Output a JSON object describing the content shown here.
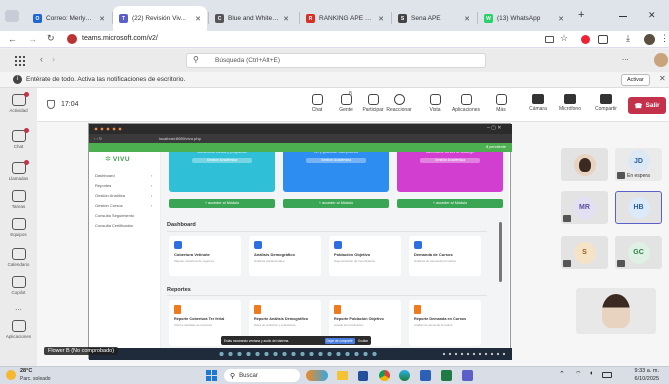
{
  "browser": {
    "tabs": [
      {
        "label": "Correo: Merlyn Elena",
        "fav_color": "#1e66d0",
        "fav": "O"
      },
      {
        "label": "(22) Revisión Viv...",
        "fav_color": "#5b5fc7",
        "fav": "T"
      },
      {
        "label": "Blue and White Mod...",
        "fav_color": "#555555",
        "fav": "C"
      },
      {
        "label": "RANKING APE SEMA...",
        "fav_color": "#d93025",
        "fav": "R"
      },
      {
        "label": "Sena APE",
        "fav_color": "#444444",
        "fav": "S"
      },
      {
        "label": "(13) WhatsApp",
        "fav_color": "#25d366",
        "fav": "W"
      }
    ],
    "new_tab": "+",
    "url": "teams.microsoft.com/v2/"
  },
  "teams": {
    "search_placeholder": "Búsqueda (Ctrl+Alt+E)",
    "more": "...",
    "notice": "Entérate de todo. Activa las notificaciones de escritorio.",
    "notice_button": "Activar",
    "rail": [
      "Actividad",
      "Chat",
      "Llamadas",
      "Tareas",
      "Equipos",
      "Calendario",
      "Copilot",
      "...",
      "Aplicaciones"
    ],
    "meeting": {
      "timer": "17:04",
      "controls": [
        "Chat",
        "Gente",
        "Participar",
        "Reaccionar",
        "Vista",
        "Aplicaciones",
        "Más",
        "Cámara",
        "Micrófono",
        "Compartir"
      ],
      "people_count": "8",
      "leave": "Salir"
    },
    "participants": [
      {
        "initials": "JD",
        "status": "En espera",
        "color": "#dde8f5",
        "text_color": "#2a5fa0"
      },
      {
        "initials": "MR",
        "color": "#e4e0f4",
        "text_color": "#5b4fa0"
      },
      {
        "initials": "HB",
        "color": "#dce9f8",
        "text_color": "#2a5fa0"
      },
      {
        "initials": "S",
        "color": "#f5e3c8",
        "text_color": "#9a5b15"
      },
      {
        "initials": "GC",
        "color": "#dff0e4",
        "text_color": "#2e7d48"
      }
    ],
    "presenter_label": "Flower B (No comprobado)"
  },
  "shared": {
    "url": "localhost:8080/vivu.php",
    "logo": "VIVU",
    "header_right": "8 pendiente",
    "sidebar": [
      "Dashboard",
      "Reportes",
      "Gestión Analítica",
      "Gestión Cursos",
      "Consulta Seguimiento",
      "Consulta Certificados"
    ],
    "cards": [
      {
        "title": "Gestión de Cursos",
        "sub": "Administrar cursos y programas",
        "btn": "Gestión Académica",
        "color": "#2fbfd6"
      },
      {
        "title": "Gestión de Cursos",
        "sub": "Ver y gestionar inscripciones",
        "btn": "Gestión Académica",
        "color": "#2e8df0"
      },
      {
        "title": "Gestión de Cursos",
        "sub": "Administrar cursos de catálogo",
        "btn": "Gestión Académica",
        "color": "#d23fd0"
      }
    ],
    "access_label": "+ acceder al Módulo",
    "dashboard_title": "Dashboard",
    "dashboard_cards": [
      {
        "title": "Cobertura Vetinote",
        "sub": "Mapear cobertura de regiones",
        "color": "#2e6fe0"
      },
      {
        "title": "Análisis Demográfico",
        "sub": "Gráficas poblacionales",
        "color": "#2e6fe0"
      },
      {
        "title": "Población Objetivo",
        "sub": "Segmentación de beneficiarios",
        "color": "#2e6fe0"
      },
      {
        "title": "Demanda de Cursos",
        "sub": "Gráficas de demanda formativa",
        "color": "#2e6fe0"
      }
    ],
    "reports_title": "Reportes",
    "report_cards": [
      {
        "title": "Reporte Cobertura Ter ferial",
        "sub": "Informe detallado de cobertura"
      },
      {
        "title": "Reporte Análisis Demográfico",
        "sub": "Datos de población y estadísticas"
      },
      {
        "title": "Reporte Población Objetivo",
        "sub": "Listado de beneficiarios"
      },
      {
        "title": "Reporte Demanda en Cursos",
        "sub": "Análisis de demanda formativa"
      }
    ],
    "share_banner": "Estás mostrando ventana y audio del sistema.",
    "stop_label": "Dejar de compartir",
    "hide_label": "Ocultar"
  },
  "windows": {
    "weather_temp": "28°C",
    "weather_text": "Parc. soleado",
    "search": "Buscar",
    "time": "9:33 a. m.",
    "date": "6/10/2025"
  }
}
